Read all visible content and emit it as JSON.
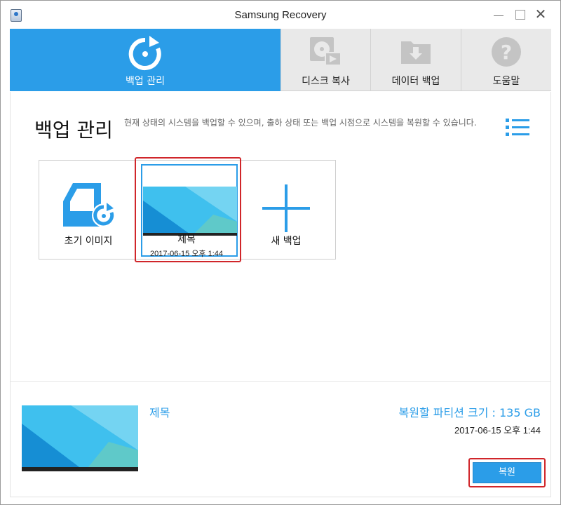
{
  "window": {
    "title": "Samsung Recovery"
  },
  "nav": {
    "tabs": [
      {
        "label": "백업 관리",
        "icon": "restore-icon",
        "active": true
      },
      {
        "label": "디스크 복사",
        "icon": "disk-copy-icon",
        "active": false
      },
      {
        "label": "데이터 백업",
        "icon": "data-backup-icon",
        "active": false
      },
      {
        "label": "도움말",
        "icon": "help-icon",
        "active": false
      }
    ]
  },
  "main": {
    "title": "백업 관리",
    "description": "현재 상태의 시스템을 백업할 수 있으며, 출하 상태 또는 백업 시점으로 시스템을 복원할 수 있습니다.",
    "cards": [
      {
        "label": "초기 이미지",
        "icon": "initial-image-icon"
      },
      {
        "label": "제목",
        "date": "2017-06-15 오후 1:44",
        "selected": true
      },
      {
        "label": "새 백업",
        "icon": "plus-icon"
      }
    ]
  },
  "detail": {
    "name": "제목",
    "partition_size": "복원할 파티션 크기 : 135 GB",
    "date": "2017-06-15 오후 1:44",
    "restore_label": "복원"
  },
  "colors": {
    "accent": "#2b9de8",
    "highlight": "#d0262a"
  }
}
